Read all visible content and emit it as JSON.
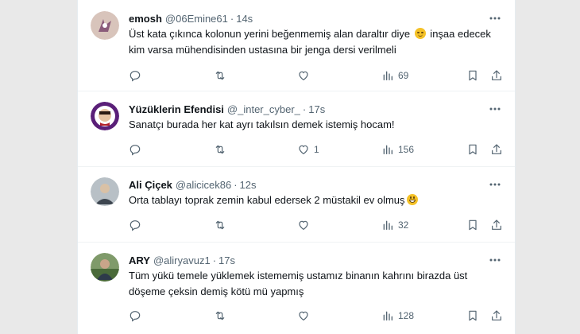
{
  "tweets": [
    {
      "name": "emosh",
      "handle": "@06Emine61",
      "time": "14s",
      "text_before": "Üst kata çıkınca kolonun yerini beğenmemiş alan daraltır diye ",
      "emoji": "smirking-face",
      "text_after": " inşaa edecek kim varsa mühendisinden ustasına bir jenga dersi verilmeli",
      "reply_count": "",
      "retweet_count": "",
      "like_count": "",
      "view_count": "69",
      "avatar_colors": [
        "#c9b3a8",
        "#7a4f6b"
      ]
    },
    {
      "name": "Yüzüklerin Efendisi",
      "handle": "@_inter_cyber_",
      "time": "17s",
      "text_before": "Sanatçı burada her kat ayrı takılsın demek istemiş hocam!",
      "emoji": "",
      "text_after": "",
      "reply_count": "",
      "retweet_count": "",
      "like_count": "1",
      "view_count": "156",
      "avatar_colors": [
        "#6a2a86",
        "#e8c9a8"
      ]
    },
    {
      "name": "Ali Çiçek",
      "handle": "@alicicek86",
      "time": "12s",
      "text_before": "Orta tablayı toprak zemin kabul edersek 2 müstakil ev olmuş",
      "emoji": "grinning-face",
      "text_after": "",
      "reply_count": "",
      "retweet_count": "",
      "like_count": "",
      "view_count": "32",
      "avatar_colors": [
        "#9aa3ab",
        "#3d4650"
      ]
    },
    {
      "name": "ARY",
      "handle": "@aliryavuz1",
      "time": "17s",
      "text_before": "Tüm yükü temele yüklemek istememiş ustamız binanın kahrını birazda üst döşeme çeksin demiş kötü mü yapmış",
      "emoji": "",
      "text_after": "",
      "reply_count": "",
      "retweet_count": "",
      "like_count": "",
      "view_count": "128",
      "avatar_colors": [
        "#5a7a4a",
        "#2d3a4a"
      ]
    }
  ],
  "icons": {
    "reply": "reply-icon",
    "retweet": "retweet-icon",
    "like": "heart-icon",
    "views": "views-icon",
    "bookmark": "bookmark-icon",
    "share": "share-icon",
    "more": "more-icon"
  },
  "colors": {
    "text": "#0f1419",
    "secondary": "#536471",
    "background": "#e9e9e9"
  }
}
